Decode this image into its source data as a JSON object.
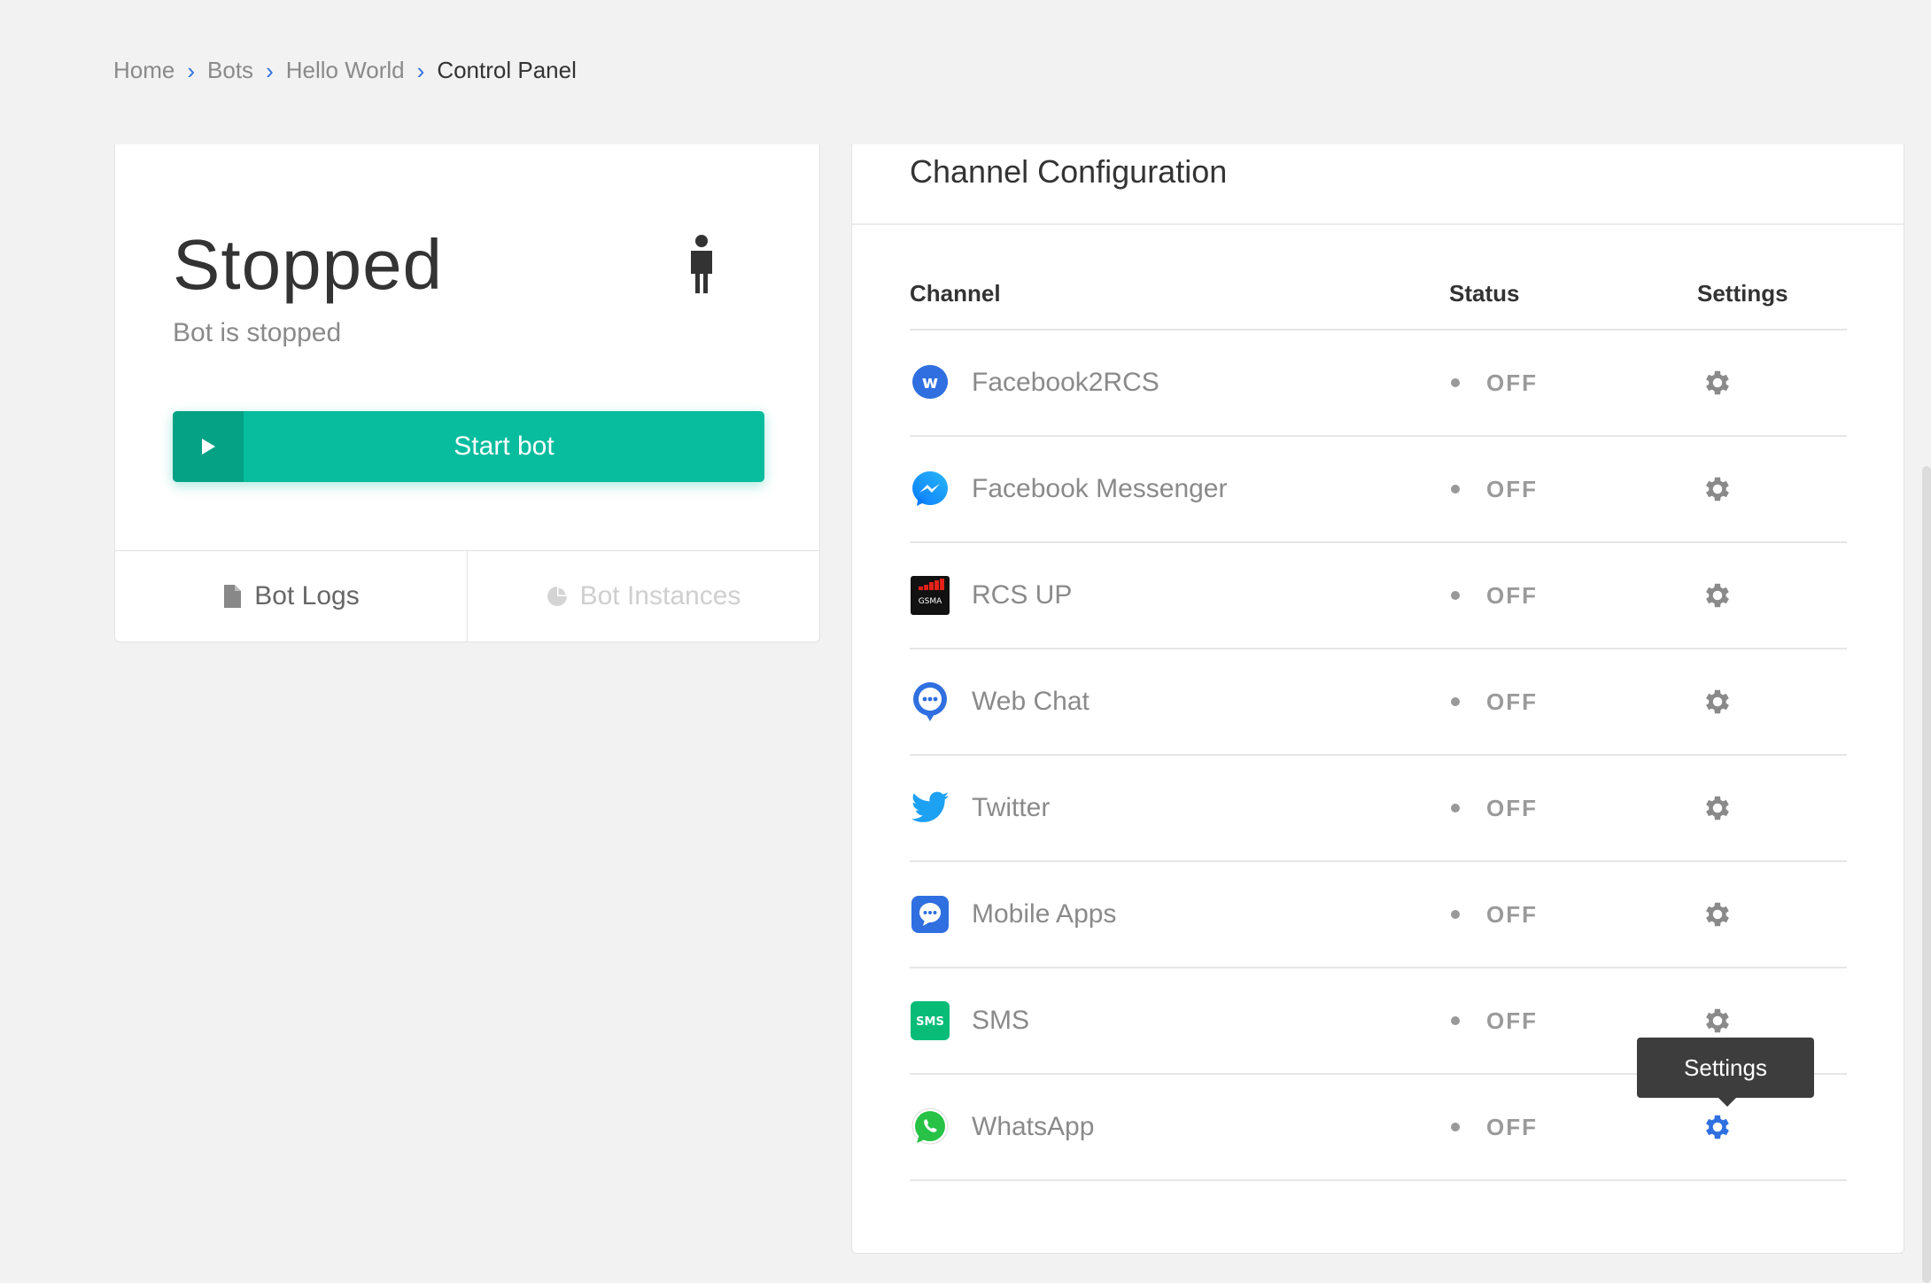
{
  "breadcrumb": {
    "items": [
      "Home",
      "Bots",
      "Hello World",
      "Control Panel"
    ]
  },
  "status_card": {
    "title": "Stopped",
    "subtitle": "Bot is stopped",
    "start_button": "Start bot",
    "tabs": [
      {
        "label": "Bot Logs",
        "icon": "file-icon"
      },
      {
        "label": "Bot Instances",
        "icon": "pie-chart-icon"
      }
    ]
  },
  "channel_config": {
    "title": "Channel Configuration",
    "headers": {
      "channel": "Channel",
      "status": "Status",
      "settings": "Settings"
    },
    "rows": [
      {
        "name": "Facebook2RCS",
        "status": "OFF",
        "icon": "facebook2rcs-icon"
      },
      {
        "name": "Facebook Messenger",
        "status": "OFF",
        "icon": "messenger-icon"
      },
      {
        "name": "RCS UP",
        "status": "OFF",
        "icon": "gsma-icon"
      },
      {
        "name": "Web Chat",
        "status": "OFF",
        "icon": "web-chat-icon"
      },
      {
        "name": "Twitter",
        "status": "OFF",
        "icon": "twitter-icon"
      },
      {
        "name": "Mobile Apps",
        "status": "OFF",
        "icon": "mobile-apps-icon"
      },
      {
        "name": "SMS",
        "status": "OFF",
        "icon": "sms-icon"
      },
      {
        "name": "WhatsApp",
        "status": "OFF",
        "icon": "whatsapp-icon"
      }
    ],
    "tooltip": "Settings"
  },
  "colors": {
    "accent_green": "#08bc9e",
    "accent_blue": "#2f6fe0",
    "gear_gray": "#8a8a8a"
  }
}
